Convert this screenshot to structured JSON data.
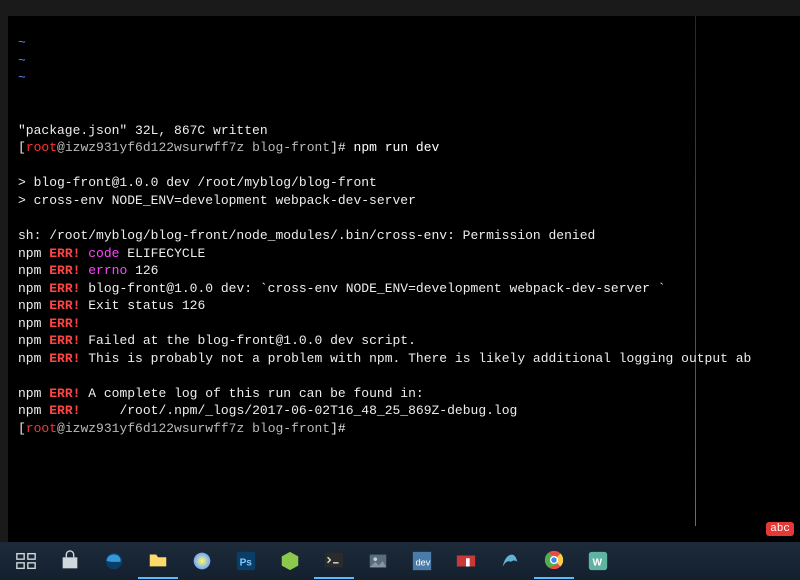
{
  "terminal": {
    "tildes": [
      "~",
      "~",
      "~"
    ],
    "write_msg": "\"package.json\" 32L, 867C written",
    "prompt1": {
      "user": "root",
      "host": "izwz931yf6d122wsurwff7z",
      "dir": "blog-front",
      "cmd": "npm run dev"
    },
    "script_hdr1": "> blog-front@1.0.0 dev /root/myblog/blog-front",
    "script_hdr2": "> cross-env NODE_ENV=development webpack-dev-server",
    "sh_err": "sh: /root/myblog/blog-front/node_modules/.bin/cross-env: Permission denied",
    "err1": {
      "label": "npm",
      "tag": "ERR!",
      "key": "code",
      "val": "ELIFECYCLE"
    },
    "err2": {
      "label": "npm",
      "tag": "ERR!",
      "key": "errno",
      "val": "126"
    },
    "err3": {
      "label": "npm",
      "tag": "ERR!",
      "text": "blog-front@1.0.0 dev: `cross-env NODE_ENV=development webpack-dev-server `"
    },
    "err4": {
      "label": "npm",
      "tag": "ERR!",
      "text": "Exit status 126"
    },
    "err5": {
      "label": "npm",
      "tag": "ERR!",
      "text": ""
    },
    "err6": {
      "label": "npm",
      "tag": "ERR!",
      "text": "Failed at the blog-front@1.0.0 dev script."
    },
    "err7": {
      "label": "npm",
      "tag": "ERR!",
      "text": "This is probably not a problem with npm. There is likely additional logging output ab"
    },
    "err8": {
      "label": "npm",
      "tag": "ERR!",
      "text": "A complete log of this run can be found in:"
    },
    "err9": {
      "label": "npm",
      "tag": "ERR!",
      "text": "    /root/.npm/_logs/2017-06-02T16_48_25_869Z-debug.log"
    },
    "prompt2": {
      "user": "root",
      "host": "izwz931yf6d122wsurwff7z",
      "dir": "blog-front",
      "cmd": ""
    }
  },
  "taskbar": {
    "items": [
      {
        "name": "task-view",
        "color": "#cfd8dc"
      },
      {
        "name": "store",
        "color": "#cfd8dc"
      },
      {
        "name": "edge",
        "color": "#3498db"
      },
      {
        "name": "file-explorer",
        "color": "#ffd96a"
      },
      {
        "name": "settings-color",
        "color": "#ff6ec7"
      },
      {
        "name": "photoshop",
        "color": "#0b3e66"
      },
      {
        "name": "nodejs",
        "color": "#8cc84b"
      },
      {
        "name": "terminal",
        "color": "#404040"
      },
      {
        "name": "image-editor",
        "color": "#5a6b7a"
      },
      {
        "name": "dev-cpp",
        "color": "#4b7ba8"
      },
      {
        "name": "npm",
        "color": "#cb3837"
      },
      {
        "name": "mysql",
        "color": "#62b1d6"
      },
      {
        "name": "chrome",
        "color": "#ffce44"
      },
      {
        "name": "wps",
        "color": "#5fb3a1"
      }
    ]
  },
  "badge": "abc"
}
